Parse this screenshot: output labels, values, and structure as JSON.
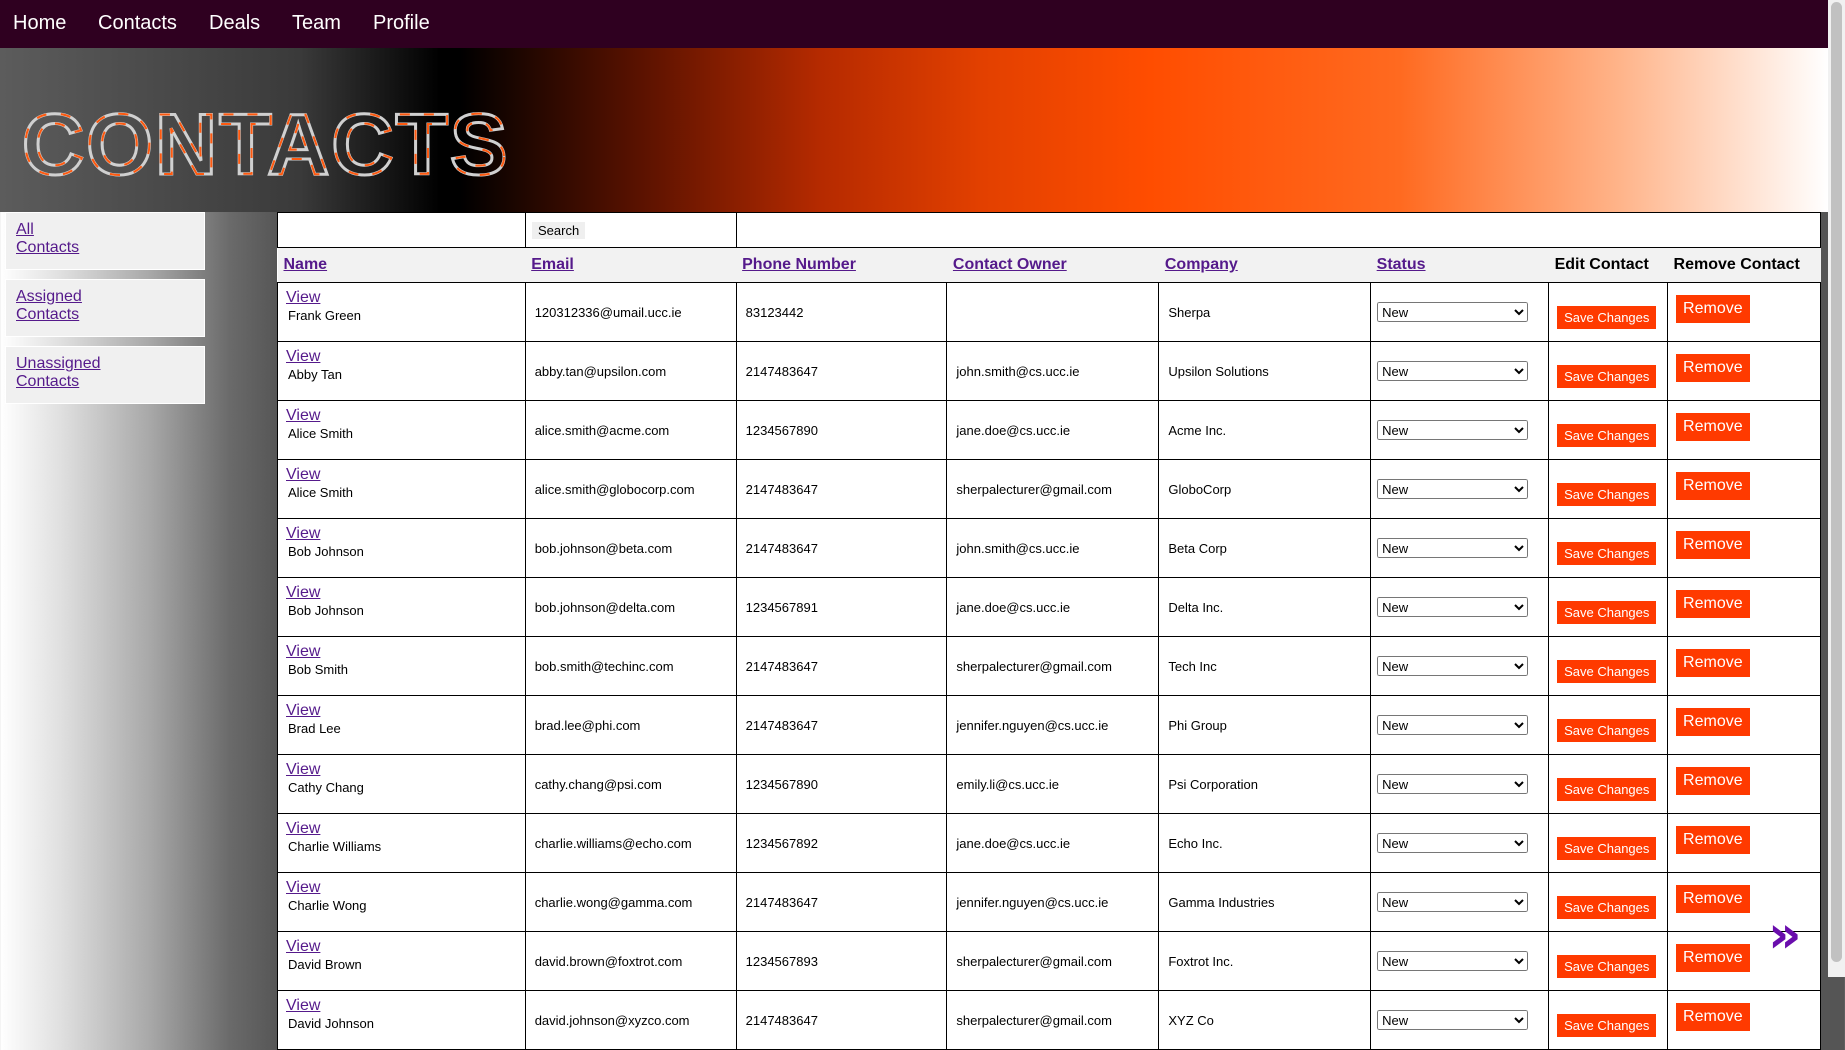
{
  "nav": [
    {
      "label": "Home"
    },
    {
      "label": "Contacts"
    },
    {
      "label": "Deals"
    },
    {
      "label": "Team"
    },
    {
      "label": "Profile"
    }
  ],
  "banner": {
    "title": "CONTACTS"
  },
  "sidebar": {
    "items": [
      {
        "line1": "All",
        "line2": "Contacts"
      },
      {
        "line1": "Assigned",
        "line2": "Contacts"
      },
      {
        "line1": "Unassigned",
        "line2": "Contacts"
      }
    ]
  },
  "search": {
    "button_label": "Search"
  },
  "table": {
    "headers": {
      "name": "Name",
      "email": "Email",
      "phone": "Phone Number",
      "owner": "Contact Owner",
      "company": "Company",
      "status": "Status",
      "edit": "Edit Contact",
      "remove": "Remove Contact"
    },
    "view_label": "View",
    "save_label": "Save Changes",
    "remove_label": "Remove",
    "rows": [
      {
        "name": "Frank Green",
        "email": "120312336@umail.ucc.ie",
        "phone": "83123442",
        "owner": "",
        "company": "Sherpa",
        "status": "New"
      },
      {
        "name": "Abby Tan",
        "email": "abby.tan@upsilon.com",
        "phone": "2147483647",
        "owner": "john.smith@cs.ucc.ie",
        "company": "Upsilon Solutions",
        "status": "New"
      },
      {
        "name": "Alice Smith",
        "email": "alice.smith@acme.com",
        "phone": "1234567890",
        "owner": "jane.doe@cs.ucc.ie",
        "company": "Acme Inc.",
        "status": "New"
      },
      {
        "name": "Alice Smith",
        "email": "alice.smith@globocorp.com",
        "phone": "2147483647",
        "owner": "sherpalecturer@gmail.com",
        "company": "GloboCorp",
        "status": "New"
      },
      {
        "name": "Bob Johnson",
        "email": "bob.johnson@beta.com",
        "phone": "2147483647",
        "owner": "john.smith@cs.ucc.ie",
        "company": "Beta Corp",
        "status": "New"
      },
      {
        "name": "Bob Johnson",
        "email": "bob.johnson@delta.com",
        "phone": "1234567891",
        "owner": "jane.doe@cs.ucc.ie",
        "company": "Delta Inc.",
        "status": "New"
      },
      {
        "name": "Bob Smith",
        "email": "bob.smith@techinc.com",
        "phone": "2147483647",
        "owner": "sherpalecturer@gmail.com",
        "company": "Tech Inc",
        "status": "New"
      },
      {
        "name": "Brad Lee",
        "email": "brad.lee@phi.com",
        "phone": "2147483647",
        "owner": "jennifer.nguyen@cs.ucc.ie",
        "company": "Phi Group",
        "status": "New"
      },
      {
        "name": "Cathy Chang",
        "email": "cathy.chang@psi.com",
        "phone": "1234567890",
        "owner": "emily.li@cs.ucc.ie",
        "company": "Psi Corporation",
        "status": "New"
      },
      {
        "name": "Charlie Williams",
        "email": "charlie.williams@echo.com",
        "phone": "1234567892",
        "owner": "jane.doe@cs.ucc.ie",
        "company": "Echo Inc.",
        "status": "New"
      },
      {
        "name": "Charlie Wong",
        "email": "charlie.wong@gamma.com",
        "phone": "2147483647",
        "owner": "jennifer.nguyen@cs.ucc.ie",
        "company": "Gamma Industries",
        "status": "New"
      },
      {
        "name": "David Brown",
        "email": "david.brown@foxtrot.com",
        "phone": "1234567893",
        "owner": "sherpalecturer@gmail.com",
        "company": "Foxtrot Inc.",
        "status": "New"
      },
      {
        "name": "David Johnson",
        "email": "david.johnson@xyzco.com",
        "phone": "2147483647",
        "owner": "sherpalecturer@gmail.com",
        "company": "XYZ Co",
        "status": "New"
      }
    ]
  },
  "pager": {
    "next_glyph": "»"
  },
  "colors": {
    "nav_bg": "#2f0020",
    "accent": "#ff3a00",
    "link": "#551a8b"
  }
}
